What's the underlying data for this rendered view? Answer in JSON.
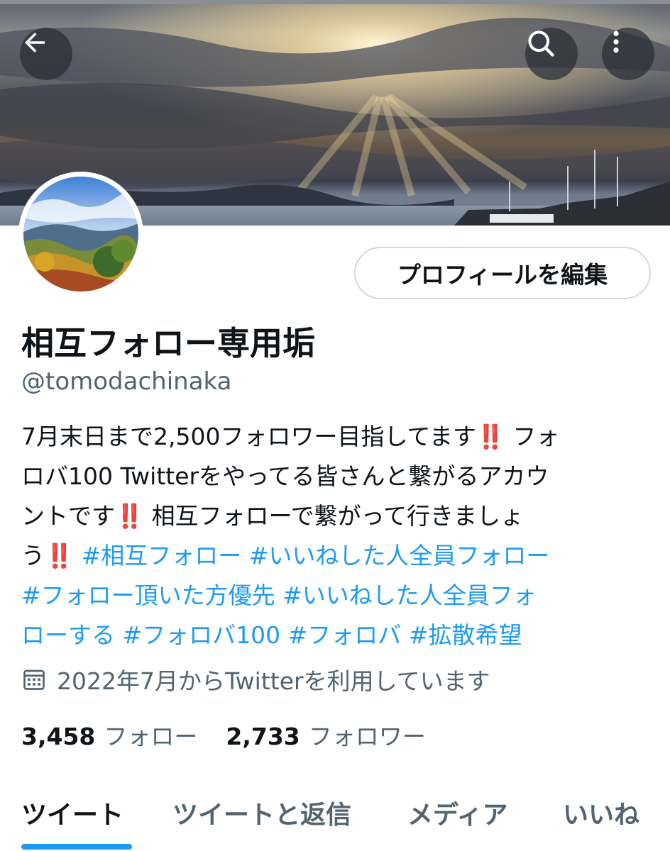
{
  "profile": {
    "name": "相互フォロー専用垢",
    "handle": "@tomodachinaka",
    "edit_button": "プロフィールを編集",
    "bio": {
      "line1_a": "7月末日まで2,500フォロワー目指してます",
      "line1_bang": "‼️",
      "line1_b": "フォ",
      "line2": "ロバ100 Twitterをやってる皆さんと繋がるアカウ",
      "line3_a": "ントです",
      "line3_bang": "‼️",
      "line3_b": " 相互フォローで繋がって行きましょ",
      "line4_a": "う",
      "line4_bang": "‼️",
      "tags": [
        "#相互フォロー",
        "#いいねした人全員フォロー",
        "#フォロー頂いた方優先",
        "#いいねした人全員フォ",
        "ローする",
        "#フォロバ100",
        "#フォロバ",
        "#拡散希望"
      ]
    },
    "joined": "2022年7月からTwitterを利用しています",
    "following_count": "3,458",
    "following_label": "フォロー",
    "followers_count": "2,733",
    "followers_label": "フォロワー"
  },
  "tabs": [
    {
      "label": "ツイート",
      "active": true
    },
    {
      "label": "ツイートと返信",
      "active": false
    },
    {
      "label": "メディア",
      "active": false
    },
    {
      "label": "いいね",
      "active": false
    }
  ],
  "icons": {
    "back": "arrow-left-icon",
    "search": "search-icon",
    "more": "more-vertical-icon",
    "calendar": "calendar-icon"
  },
  "colors": {
    "accent": "#1d9bf0",
    "text": "#0f1419",
    "secondary": "#536471",
    "emphasis": "#e0245e"
  }
}
